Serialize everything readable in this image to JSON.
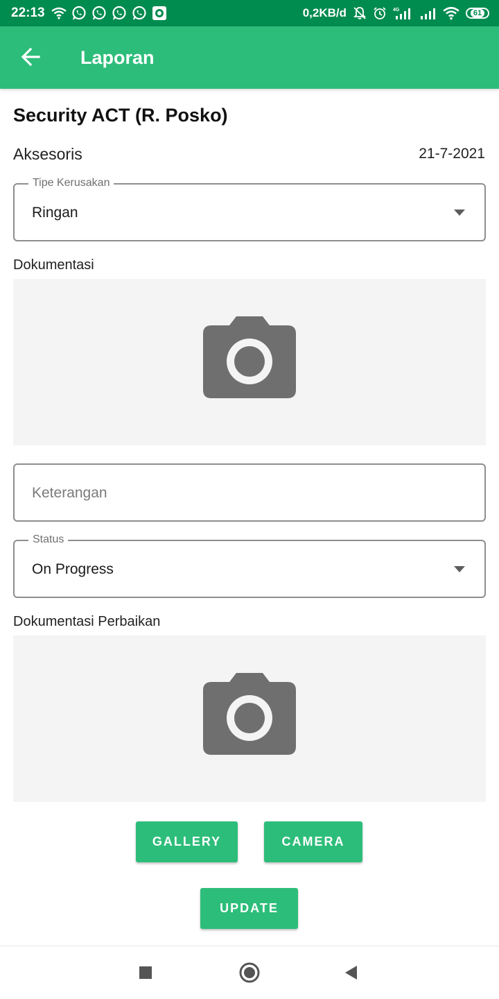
{
  "status_bar": {
    "time": "22:13",
    "speed": "0,2KB/d",
    "battery": "61",
    "network": "4G",
    "left_icons": [
      "wifi-icon",
      "whatsapp-icon",
      "whatsapp-icon",
      "whatsapp-icon",
      "whatsapp-icon",
      "screen-record-icon"
    ],
    "right_icons": [
      "mute-icon",
      "alarm-icon",
      "signal-icon",
      "signal-icon",
      "wifi-icon",
      "battery-icon"
    ]
  },
  "app_bar": {
    "title": "Laporan",
    "back_icon": "arrow-back-icon"
  },
  "header": {
    "title": "Security ACT (R. Posko)",
    "category": "Aksesoris",
    "date": "21-7-2021"
  },
  "damage_type": {
    "label": "Tipe Kerusakan",
    "value": "Ringan"
  },
  "documentation": {
    "label": "Dokumentasi",
    "icon": "camera-icon"
  },
  "description": {
    "placeholder": "Keterangan"
  },
  "status_field": {
    "label": "Status",
    "value": "On Progress"
  },
  "repair_documentation": {
    "label": "Dokumentasi Perbaikan",
    "icon": "camera-icon"
  },
  "buttons": {
    "gallery": "GALLERY",
    "camera": "CAMERA",
    "update": "UPDATE"
  },
  "nav_bar": {
    "icons": [
      "recents-square-icon",
      "home-circle-icon",
      "back-triangle-icon"
    ]
  },
  "colors": {
    "status_bar": "#008b4f",
    "primary": "#2dbd7a",
    "photo_bg": "#f4f4f4",
    "camera_icon": "#6f6f6f"
  }
}
